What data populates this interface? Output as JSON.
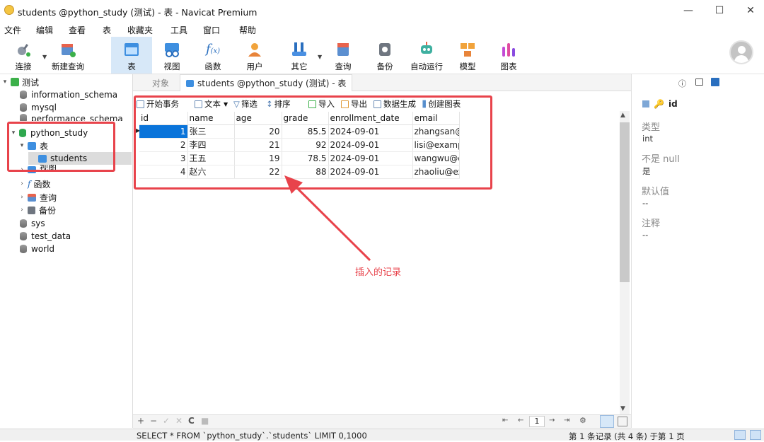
{
  "window": {
    "title": "students @python_study (测试) - 表 - Navicat Premium",
    "controls": {
      "minimize": "—",
      "maximize": "☐",
      "close": "✕"
    }
  },
  "menu": [
    "文件",
    "编辑",
    "查看",
    "表",
    "收藏夹",
    "工具",
    "窗口",
    "帮助"
  ],
  "toolbar": {
    "items": [
      {
        "label": "连接",
        "icon": "plug-icon"
      },
      {
        "label": "新建查询",
        "icon": "new-query-icon"
      },
      {
        "label": "表",
        "icon": "table-icon",
        "active": true
      },
      {
        "label": "视图",
        "icon": "view-icon"
      },
      {
        "label": "函数",
        "icon": "function-icon"
      },
      {
        "label": "用户",
        "icon": "user-icon"
      },
      {
        "label": "其它",
        "icon": "tools-icon"
      },
      {
        "label": "查询",
        "icon": "query-icon"
      },
      {
        "label": "备份",
        "icon": "backup-icon"
      },
      {
        "label": "自动运行",
        "icon": "robot-icon"
      },
      {
        "label": "模型",
        "icon": "model-icon"
      },
      {
        "label": "图表",
        "icon": "chart-icon"
      }
    ]
  },
  "sidebar": {
    "connection": "测试",
    "databases": [
      "information_schema",
      "mysql",
      "performance_schema",
      "python_study",
      "sys",
      "test_data",
      "world"
    ],
    "selected_db": "python_study",
    "tables_folder": "表",
    "selected_table": "students",
    "other_folders": [
      "视图",
      "函数",
      "查询",
      "备份"
    ]
  },
  "tabs": {
    "objects": "对象",
    "active": "students @python_study (测试) - 表"
  },
  "grid_toolbar": [
    "开始事务",
    "文本",
    "筛选",
    "排序",
    "导入",
    "导出",
    "数据生成",
    "创建图表"
  ],
  "table": {
    "columns": [
      "id",
      "name",
      "age",
      "grade",
      "enrollment_date",
      "email"
    ],
    "rows": [
      [
        "1",
        "张三",
        "20",
        "85.5",
        "2024-09-01",
        "zhangsan@e"
      ],
      [
        "2",
        "李四",
        "21",
        "92",
        "2024-09-01",
        "lisi@examp"
      ],
      [
        "3",
        "王五",
        "19",
        "78.5",
        "2024-09-01",
        "wangwu@e"
      ],
      [
        "4",
        "赵六",
        "22",
        "88",
        "2024-09-01",
        "zhaoliu@ex"
      ]
    ]
  },
  "annotation": {
    "text": "插入的记录",
    "color": "#e8434b"
  },
  "right_panel": {
    "field_name": "id",
    "type_label": "类型",
    "type_value": "int",
    "notnull_label": "不是 null",
    "notnull_value": "是",
    "default_label": "默认值",
    "default_value": "--",
    "comment_label": "注释",
    "comment_value": "--"
  },
  "bottom": {
    "nav_controls": [
      "+",
      "−",
      "✓",
      "✕",
      "C",
      "■"
    ],
    "page": "1"
  },
  "status": {
    "sql": "SELECT * FROM `python_study`.`students` LIMIT 0,1000",
    "record": "第 1 条记录 (共 4 条) 于第 1 页"
  }
}
